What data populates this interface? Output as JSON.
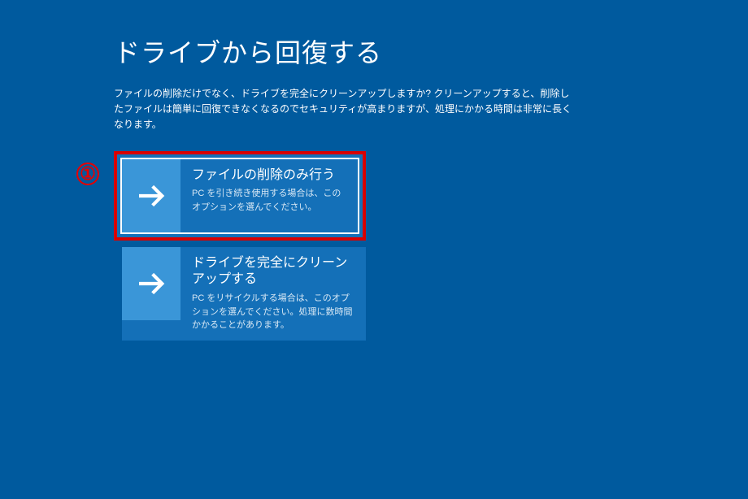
{
  "header": {
    "title": "ドライブから回復する"
  },
  "description": "ファイルの削除だけでなく、ドライブを完全にクリーンアップしますか? クリーンアップすると、削除したファイルは簡単に回復できなくなるのでセキュリティが高まりますが、処理にかかる時間は非常に長くなります。",
  "annotation": {
    "marker": "①"
  },
  "options": [
    {
      "title": "ファイルの削除のみ行う",
      "description": "PC を引き続き使用する場合は、このオプションを選んでください。",
      "highlighted": true
    },
    {
      "title": "ドライブを完全にクリーンアップする",
      "description": "PC をリサイクルする場合は、このオプションを選んでください。処理に数時間かかることがあります。",
      "highlighted": false
    }
  ]
}
